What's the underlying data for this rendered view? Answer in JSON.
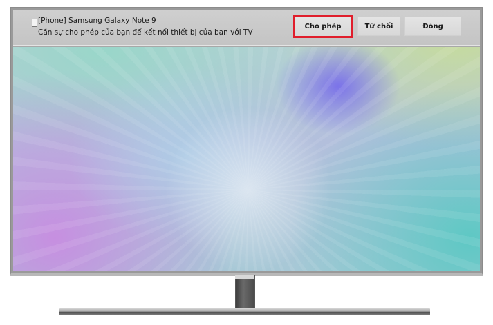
{
  "notification": {
    "device_name": "[Phone] Samsung Galaxy Note 9",
    "message": "Cần sự cho phép của bạn để kết nối thiết bị của bạn với TV",
    "device_icon": "phone-icon"
  },
  "buttons": {
    "allow_label": "Cho phép",
    "deny_label": "Từ chối",
    "close_label": "Đóng"
  },
  "colors": {
    "highlight": "#e01e2c",
    "bar_background": "#c8c8c8",
    "button_background": "#dedede"
  },
  "highlighted_button": "allow"
}
